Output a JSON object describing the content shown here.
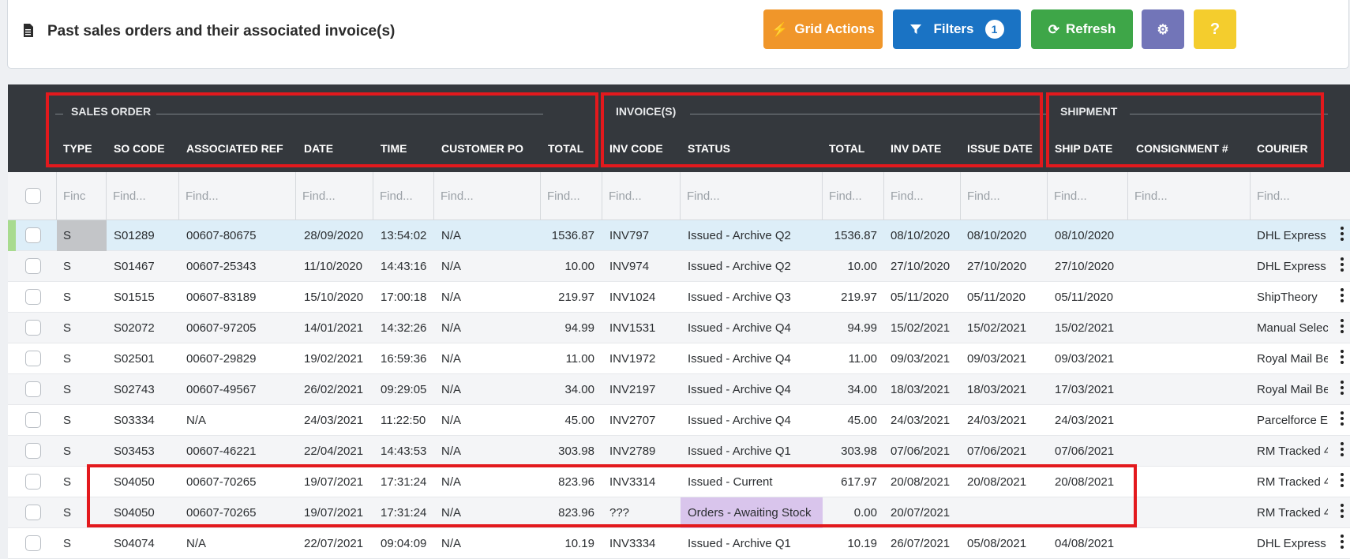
{
  "header": {
    "title": "Past sales orders and their associated invoice(s)",
    "doc_icon": "spreadsheet-icon",
    "buttons": {
      "grid_actions": "Grid Actions",
      "filters": "Filters",
      "filters_count": "1",
      "refresh": "Refresh",
      "settings_icon": "gear-icon",
      "help": "?"
    },
    "colors": {
      "grid_actions": "#f0962a",
      "filters": "#1a73c4",
      "refresh": "#3ea648",
      "settings": "#7275b8",
      "help": "#f4cd2d"
    }
  },
  "groups": {
    "sales_order": "SALES ORDER",
    "invoices": "INVOICE(S)",
    "shipment": "SHIPMENT"
  },
  "columns": {
    "type": "TYPE",
    "so_code": "SO CODE",
    "assoc_ref": "ASSOCIATED REF",
    "date": "DATE",
    "time": "TIME",
    "customer_po": "CUSTOMER PO",
    "total": "TOTAL",
    "inv_code": "INV CODE",
    "status": "STATUS",
    "inv_total": "TOTAL",
    "inv_date": "INV DATE",
    "issue_date": "ISSUE DATE",
    "ship_date": "SHIP DATE",
    "consignment": "CONSIGNMENT #",
    "courier": "COURIER"
  },
  "filters": {
    "type_placeholder": "Finc",
    "placeholder": "Find..."
  },
  "rows": [
    {
      "type": "S",
      "so": "S01289",
      "ref": "00607-80675",
      "date": "28/09/2020",
      "time": "13:54:02",
      "po": "N/A",
      "total": "1536.87",
      "inv": "INV797",
      "status": "Issued - Archive Q2",
      "inv_total": "1536.87",
      "inv_date": "08/10/2020",
      "issue": "08/10/2020",
      "ship": "08/10/2020",
      "cons": "",
      "courier": "DHL Express"
    },
    {
      "type": "S",
      "so": "S01467",
      "ref": "00607-25343",
      "date": "11/10/2020",
      "time": "14:43:16",
      "po": "N/A",
      "total": "10.00",
      "inv": "INV974",
      "status": "Issued - Archive Q2",
      "inv_total": "10.00",
      "inv_date": "27/10/2020",
      "issue": "27/10/2020",
      "ship": "27/10/2020",
      "cons": "",
      "courier": "DHL Express"
    },
    {
      "type": "S",
      "so": "S01515",
      "ref": "00607-83189",
      "date": "15/10/2020",
      "time": "17:00:18",
      "po": "N/A",
      "total": "219.97",
      "inv": "INV1024",
      "status": "Issued - Archive Q3",
      "inv_total": "219.97",
      "inv_date": "05/11/2020",
      "issue": "05/11/2020",
      "ship": "05/11/2020",
      "cons": "",
      "courier": "ShipTheory"
    },
    {
      "type": "S",
      "so": "S02072",
      "ref": "00607-97205",
      "date": "14/01/2021",
      "time": "14:32:26",
      "po": "N/A",
      "total": "94.99",
      "inv": "INV1531",
      "status": "Issued - Archive Q4",
      "inv_total": "94.99",
      "inv_date": "15/02/2021",
      "issue": "15/02/2021",
      "ship": "15/02/2021",
      "cons": "",
      "courier": "Manual Selec"
    },
    {
      "type": "S",
      "so": "S02501",
      "ref": "00607-29829",
      "date": "19/02/2021",
      "time": "16:59:36",
      "po": "N/A",
      "total": "11.00",
      "inv": "INV1972",
      "status": "Issued - Archive Q4",
      "inv_total": "11.00",
      "inv_date": "09/03/2021",
      "issue": "09/03/2021",
      "ship": "09/03/2021",
      "cons": "",
      "courier": "Royal Mail Be"
    },
    {
      "type": "S",
      "so": "S02743",
      "ref": "00607-49567",
      "date": "26/02/2021",
      "time": "09:29:05",
      "po": "N/A",
      "total": "34.00",
      "inv": "INV2197",
      "status": "Issued - Archive Q4",
      "inv_total": "34.00",
      "inv_date": "18/03/2021",
      "issue": "18/03/2021",
      "ship": "17/03/2021",
      "cons": "",
      "courier": "Royal Mail Be"
    },
    {
      "type": "S",
      "so": "S03334",
      "ref": "N/A",
      "date": "24/03/2021",
      "time": "11:22:50",
      "po": "N/A",
      "total": "45.00",
      "inv": "INV2707",
      "status": "Issued - Archive Q4",
      "inv_total": "45.00",
      "inv_date": "24/03/2021",
      "issue": "24/03/2021",
      "ship": "24/03/2021",
      "cons": "",
      "courier": "Parcelforce E"
    },
    {
      "type": "S",
      "so": "S03453",
      "ref": "00607-46221",
      "date": "22/04/2021",
      "time": "14:43:53",
      "po": "N/A",
      "total": "303.98",
      "inv": "INV2789",
      "status": "Issued - Archive Q1",
      "inv_total": "303.98",
      "inv_date": "07/06/2021",
      "issue": "07/06/2021",
      "ship": "07/06/2021",
      "cons": "",
      "courier": "RM Tracked 4"
    },
    {
      "type": "S",
      "so": "S04050",
      "ref": "00607-70265",
      "date": "19/07/2021",
      "time": "17:31:24",
      "po": "N/A",
      "total": "823.96",
      "inv": "INV3314",
      "status": "Issued - Current",
      "inv_total": "617.97",
      "inv_date": "20/08/2021",
      "issue": "20/08/2021",
      "ship": "20/08/2021",
      "cons": "",
      "courier": "RM Tracked 4"
    },
    {
      "type": "S",
      "so": "S04050",
      "ref": "00607-70265",
      "date": "19/07/2021",
      "time": "17:31:24",
      "po": "N/A",
      "total": "823.96",
      "inv": "???",
      "status": "Orders - Awaiting Stock",
      "inv_total": "0.00",
      "inv_date": "20/07/2021",
      "issue": "",
      "ship": "",
      "cons": "",
      "courier": "RM Tracked 4"
    },
    {
      "type": "S",
      "so": "S04074",
      "ref": "N/A",
      "date": "22/07/2021",
      "time": "09:04:09",
      "po": "N/A",
      "total": "10.19",
      "inv": "INV3334",
      "status": "Issued - Archive Q1",
      "inv_total": "10.19",
      "inv_date": "26/07/2021",
      "issue": "05/08/2021",
      "ship": "04/08/2021",
      "cons": "",
      "courier": "DHL Express"
    }
  ]
}
